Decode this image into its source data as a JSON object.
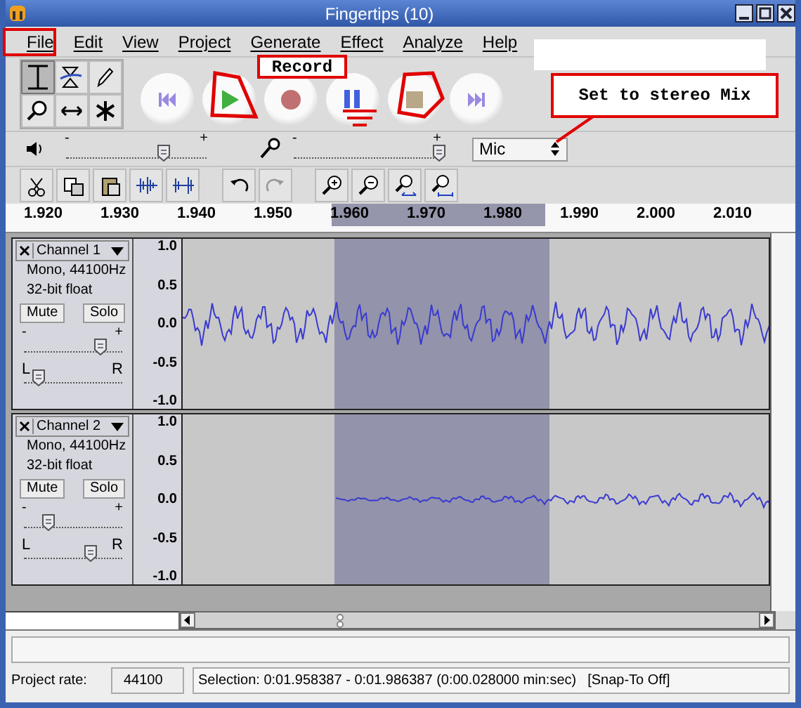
{
  "window": {
    "title": "Fingertips (10)"
  },
  "menu": [
    {
      "label": "File"
    },
    {
      "label": "Edit"
    },
    {
      "label": "View"
    },
    {
      "label": "Project"
    },
    {
      "label": "Generate"
    },
    {
      "label": "Effect"
    },
    {
      "label": "Analyze"
    },
    {
      "label": "Help"
    }
  ],
  "tools": [
    {
      "kind": "ibeam",
      "selected": true
    },
    {
      "kind": "envelope",
      "selected": false
    },
    {
      "kind": "pencil",
      "selected": false
    },
    {
      "kind": "zoom",
      "selected": false
    },
    {
      "kind": "timeshift",
      "selected": false
    },
    {
      "kind": "multi",
      "selected": false
    }
  ],
  "transport": [
    {
      "kind": "skip-start"
    },
    {
      "kind": "play"
    },
    {
      "kind": "record"
    },
    {
      "kind": "pause"
    },
    {
      "kind": "stop"
    },
    {
      "kind": "skip-end"
    }
  ],
  "mixer": {
    "output": {
      "min": "-",
      "max": "+",
      "level": 0.69
    },
    "input": {
      "min": "-",
      "max": "+",
      "level": 0.99
    },
    "source": "Mic"
  },
  "edit_tools": [
    {
      "kind": "cut"
    },
    {
      "kind": "copy"
    },
    {
      "kind": "paste"
    },
    {
      "kind": "trim"
    },
    {
      "kind": "silence"
    },
    {
      "kind": "undo"
    },
    {
      "kind": "redo"
    },
    {
      "kind": "zoom-in"
    },
    {
      "kind": "zoom-out"
    },
    {
      "kind": "fit-selection"
    },
    {
      "kind": "fit-project"
    }
  ],
  "ruler": {
    "ticks": [
      "1.920",
      "1.930",
      "1.940",
      "1.950",
      "1.960",
      "1.970",
      "1.980",
      "1.990",
      "2.000",
      "2.010"
    ]
  },
  "tracks": [
    {
      "name": "Channel 1",
      "format": "Mono, 44100Hz",
      "sample": "32-bit float",
      "mute": "Mute",
      "solo": "Solo",
      "gain": {
        "min": "-",
        "max": "+",
        "level": 0.78
      },
      "pan": {
        "left": "L",
        "right": "R",
        "level": 0.15
      },
      "scale": [
        "1.0",
        "0.5",
        "0.0",
        "-0.5",
        "-1.0"
      ]
    },
    {
      "name": "Channel 2",
      "format": "Mono, 44100Hz",
      "sample": "32-bit float",
      "mute": "Mute",
      "solo": "Solo",
      "gain": {
        "min": "-",
        "max": "+",
        "level": 0.25
      },
      "pan": {
        "left": "L",
        "right": "R",
        "level": 0.68
      },
      "scale": [
        "1.0",
        "0.5",
        "0.0",
        "-0.5",
        "-1.0"
      ]
    }
  ],
  "status": {
    "rate_label": "Project rate:",
    "rate": "44100",
    "selection": "Selection: 0:01.958387 - 0:01.986387 (0:00.028000 min:sec)",
    "snap": "[Snap-To Off]"
  },
  "annotations": [
    {
      "kind": "record-label",
      "text": "Record"
    },
    {
      "kind": "note",
      "text": "Set to stereo Mix"
    }
  ]
}
